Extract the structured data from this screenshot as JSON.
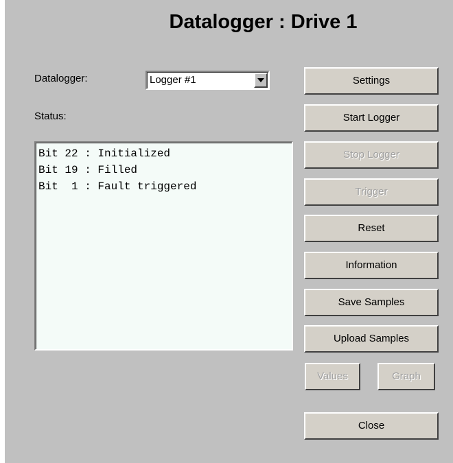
{
  "window": {
    "title": "Datalogger : Drive 1"
  },
  "datalogger": {
    "label": "Datalogger:",
    "selected": "Logger #1"
  },
  "status": {
    "label": "Status:",
    "lines": [
      "Bit 22 : Initialized",
      "Bit 19 : Filled",
      "Bit  1 : Fault triggered"
    ]
  },
  "buttons": {
    "settings": "Settings",
    "start_logger": "Start Logger",
    "stop_logger": "Stop Logger",
    "trigger": "Trigger",
    "reset": "Reset",
    "information": "Information",
    "save_samples": "Save Samples",
    "upload_samples": "Upload Samples",
    "values": "Values",
    "graph": "Graph",
    "close": "Close"
  },
  "state": {
    "stop_logger_enabled": false,
    "trigger_enabled": false,
    "values_enabled": false,
    "graph_enabled": false
  },
  "icons": {
    "combo_arrow": "chevron-down-icon"
  },
  "colors": {
    "dialog_background": "#c0c0c0",
    "textarea_background": "#f4fbf8",
    "button_face": "#d4d0c8",
    "disabled_text": "#a0a0a0"
  }
}
